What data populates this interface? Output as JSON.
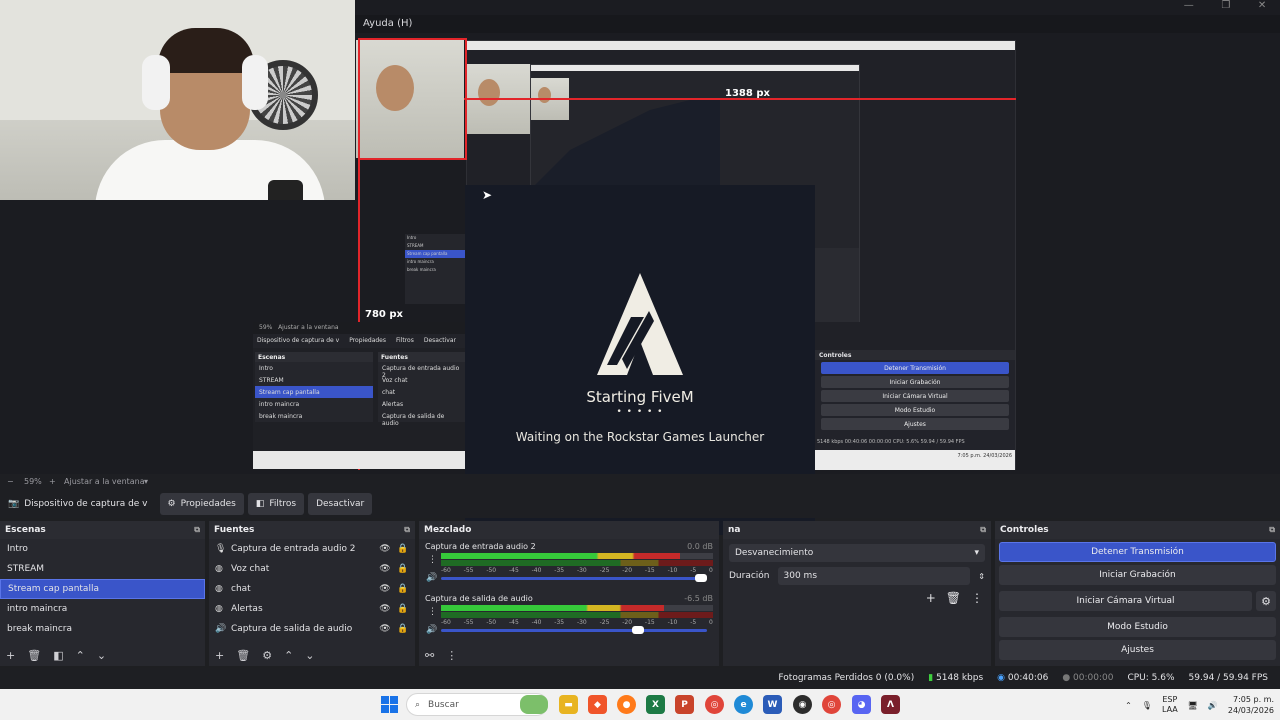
{
  "window": {
    "menu_label": "Ayuda (H)"
  },
  "nested": {
    "width_label": "1388 px",
    "height_label": "780 px",
    "mini_bar": {
      "zoom": "59%",
      "fit": "Ajustar a la ventana"
    },
    "mini_toolbar": [
      "Dispositivo de captura de v",
      "Propiedades",
      "Filtros",
      "Desactivar"
    ],
    "mini_scenes_header": "Escenas",
    "mini_sources_header": "Fuentes",
    "mini_scenes": [
      "Intro",
      "STREAM",
      "Stream cap pantalla",
      "intro maincra",
      "break maincra"
    ],
    "mini_sources": [
      "Captura de entrada audio 2",
      "Voz chat",
      "chat",
      "Alertas",
      "Captura de salida de audio"
    ],
    "mini_controls_header": "Controles",
    "mini_controls": [
      "Detener Transmisión",
      "Iniciar Grabación",
      "Iniciar Cámara Virtual",
      "Modo Estudio",
      "Ajustes"
    ],
    "mini_status": "5148 kbps  00:40:06  00:00:00  CPU: 5.6%  59.94 / 59.94 FPS",
    "mini_clock": "7:05 p.m. 24/03/2026"
  },
  "fivem": {
    "title": "Starting FiveM",
    "dots": "• • • • •",
    "subtitle": "Waiting on the Rockstar Games Launcher",
    "colors": {
      "bg": "#161a25",
      "logo": "#f0ede4"
    }
  },
  "zoombar": {
    "minus": "−",
    "zoom": "59%",
    "plus": "+",
    "fit": "Ajustar a la ventana"
  },
  "source_toolbar": {
    "source_name": "Dispositivo de captura de v",
    "properties": "Propiedades",
    "filters": "Filtros",
    "deactivate": "Desactivar"
  },
  "scenes": {
    "title": "Escenas",
    "items": [
      "Intro",
      "STREAM",
      "Stream cap pantalla",
      "intro maincra",
      "break maincra"
    ],
    "selected_index": 2
  },
  "sources": {
    "title": "Fuentes",
    "items": [
      {
        "label": "Captura de entrada audio 2",
        "icon": "microphone-icon"
      },
      {
        "label": "Voz chat",
        "icon": "globe-icon"
      },
      {
        "label": "chat",
        "icon": "globe-icon"
      },
      {
        "label": "Alertas",
        "icon": "globe-icon"
      },
      {
        "label": "Captura de salida de audio",
        "icon": "speaker-icon"
      }
    ]
  },
  "mixer": {
    "title": "Mezclado",
    "channels": [
      {
        "name": "Captura de entrada audio 2",
        "db": "0.0 dB",
        "volume": 1.0
      },
      {
        "name": "Captura de salida de audio",
        "db": "-6.5 dB",
        "volume": 0.75
      }
    ],
    "ticks": [
      "-60",
      "-55",
      "-50",
      "-45",
      "-40",
      "-35",
      "-30",
      "-25",
      "-20",
      "-15",
      "-10",
      "-5",
      "0"
    ]
  },
  "transitions": {
    "title": "na",
    "selected": "Desvanecimiento",
    "duration_label": "Duración",
    "duration_value": "300 ms"
  },
  "controls": {
    "title": "Controles",
    "stop_stream": "Detener Transmisión",
    "start_recording": "Iniciar Grabación",
    "start_virtual_cam": "Iniciar Cámara Virtual",
    "studio_mode": "Modo Estudio",
    "settings": "Ajustes"
  },
  "status": {
    "dropped_frames": "Fotogramas Perdidos 0 (0.0%)",
    "bitrate": "5148 kbps",
    "live_time": "00:40:06",
    "rec_time": "00:00:00",
    "cpu": "CPU: 5.6%",
    "fps": "59.94 / 59.94 FPS"
  },
  "taskbar": {
    "search_placeholder": "Buscar",
    "lang_top": "ESP",
    "lang_bottom": "LAA",
    "time": "7:05 p. m.",
    "date": "24/03/2026",
    "colors": {
      "accent": "#1a73e8",
      "obs_blue": "#3a55c9"
    }
  }
}
